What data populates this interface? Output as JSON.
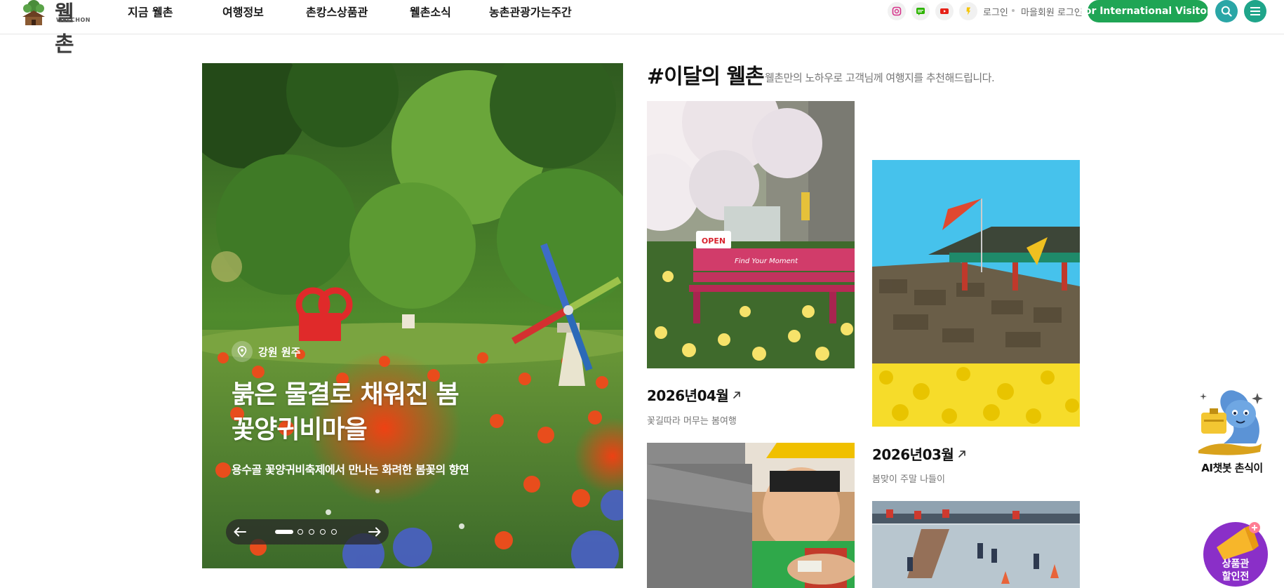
{
  "header": {
    "logo_text": "웰촌",
    "logo_sub": "WELCHON",
    "nav": [
      "지금 웰촌",
      "여행정보",
      "촌캉스상품관",
      "웰촌소식",
      "농촌관광가는주간"
    ],
    "sns": [
      "instagram-icon",
      "blog-icon",
      "youtube-icon",
      "kakao-story-icon"
    ],
    "login": "로그인",
    "village_login": "마을회원 로그인",
    "intl_button": "For International Visitors",
    "colors": {
      "brand_green": "#1fa555",
      "teal": "#2aa6a6"
    }
  },
  "hero": {
    "location": "강원 원주",
    "title_line1": "붉은 물결로 채워진 봄",
    "title_line2": "꽃양귀비마을",
    "description": "용수골 꽃양귀비축제에서 만나는 화려한 봄꽃의 향연",
    "slide_count": 5,
    "active_slide": 1
  },
  "monthly": {
    "title": "#이달의 웰촌",
    "description": "웰촌만의 노하우로 고객님께 여행지를 추천해드립니다.",
    "cards": [
      {
        "month": "2026년04월",
        "subtitle": "꽃길따라 머무는 봄여행",
        "sign_open": "OPEN",
        "bench_text": "Find Your Moment"
      },
      {
        "month": "2026년03월",
        "subtitle": "봄맞이 주말 나들이"
      }
    ]
  },
  "floating": {
    "chatbot_label": "AI챗봇 촌식이",
    "promo_line1": "상품관",
    "promo_line2": "할인전"
  }
}
